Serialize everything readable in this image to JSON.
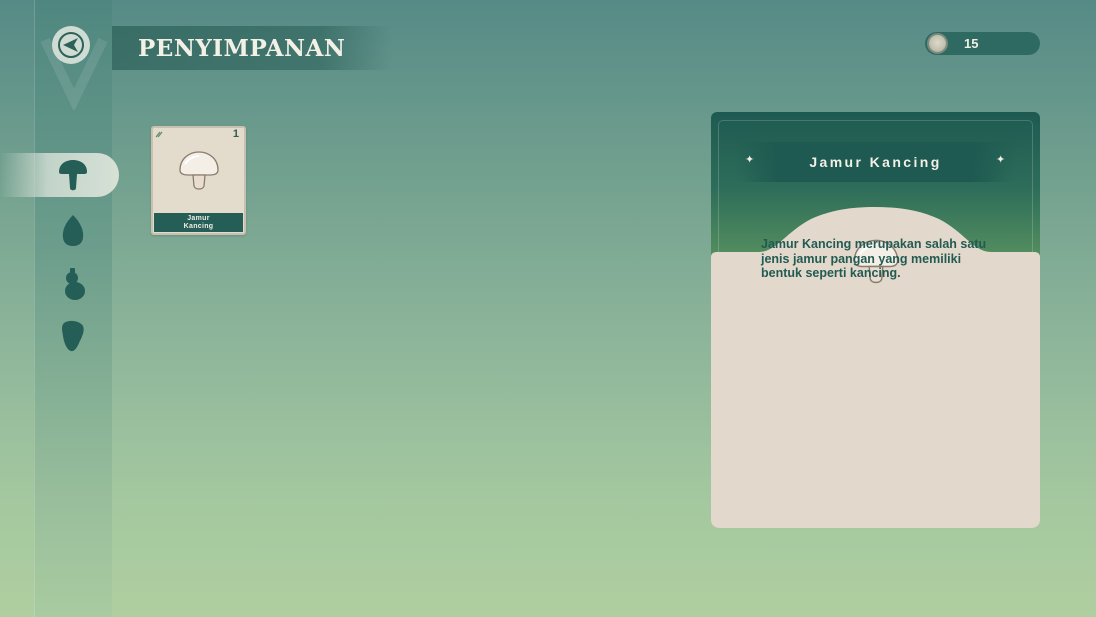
{
  "header": {
    "title": "PENYIMPANAN",
    "coins": "15"
  },
  "sidebar": {
    "tabs": [
      {
        "name": "mushroom",
        "active": true
      },
      {
        "name": "seed",
        "active": false
      },
      {
        "name": "gourd",
        "active": false
      },
      {
        "name": "root",
        "active": false
      }
    ]
  },
  "inventory": {
    "slots": [
      {
        "item_label": "Jamur\nKancing",
        "quantity": "1",
        "icon": "button-mushroom-icon"
      }
    ]
  },
  "detail": {
    "name": "Jamur Kancing",
    "description": "Jamur Kancing merupakan salah satu jenis jamur pangan yang memiliki bentuk seperti kancing.",
    "icon": "button-mushroom-icon"
  },
  "colors": {
    "accent_dark": "#1e5a51",
    "card_bg": "#e3dbcc",
    "text_dark": "#235a52"
  }
}
